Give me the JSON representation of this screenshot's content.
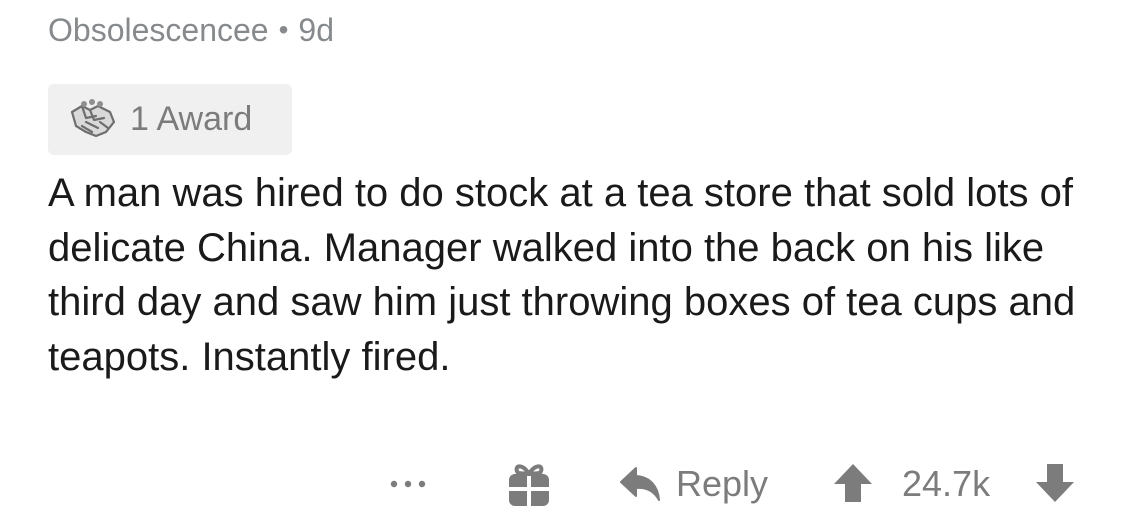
{
  "comment": {
    "author": "Obsolescencee",
    "separator": "•",
    "age": "9d",
    "award": {
      "icon": "handshake-award-icon",
      "label": "1 Award"
    },
    "body": "A man was hired to do stock at a tea store that sold lots of delicate China. Manager walked into the back on his like third day and saw him just throwing boxes of tea cups and teapots. Instantly fired."
  },
  "actions": {
    "more_icon": "more-dots-icon",
    "more_label": "•••",
    "gift_icon": "gift-icon",
    "reply_icon": "reply-arrow-icon",
    "reply_label": "Reply",
    "upvote_icon": "upvote-arrow-icon",
    "score": "24.7k",
    "downvote_icon": "downvote-arrow-icon"
  },
  "colors": {
    "meta_text": "#878a8c",
    "body_text": "#1a1a1b",
    "action_gray": "#7c7c7c",
    "chip_bg": "#f0f0f0"
  }
}
